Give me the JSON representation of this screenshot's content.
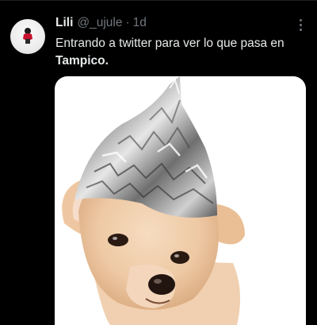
{
  "tweet": {
    "author": {
      "display_name": "Lili",
      "handle": "@_ujule",
      "separator": "·",
      "time": "1d"
    },
    "text_line1": "Entrando a twitter para ver lo que pasa en",
    "text_line2": "Tampico.",
    "icons": {
      "more": "more-horizontal-icon",
      "avatar": "avatar-image"
    },
    "media": {
      "alt": "Dog wearing a tinfoil hat"
    },
    "colors": {
      "background": "#000000",
      "primary_text": "#e7e9ea",
      "secondary_text": "#71767b"
    }
  }
}
